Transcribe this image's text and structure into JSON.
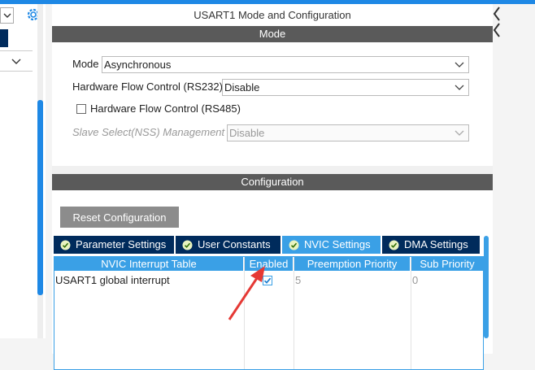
{
  "window": {
    "title": "USART1 Mode and Configuration"
  },
  "mode_section": {
    "header": "Mode",
    "mode_label": "Mode",
    "mode_value": "Asynchronous",
    "hfc232_label": "Hardware Flow Control (RS232)",
    "hfc232_value": "Disable",
    "hfc485_label": "Hardware Flow Control (RS485)",
    "hfc485_checked": false,
    "nss_label": "Slave Select(NSS) Management",
    "nss_value": "Disable"
  },
  "config_section": {
    "header": "Configuration",
    "reset_label": "Reset Configuration",
    "tabs": [
      {
        "label": "Parameter Settings",
        "active": false
      },
      {
        "label": "User Constants",
        "active": false
      },
      {
        "label": "NVIC Settings",
        "active": true
      },
      {
        "label": "DMA Settings",
        "active": false
      }
    ],
    "table": {
      "columns": [
        "NVIC Interrupt Table",
        "Enabled",
        "Preemption Priority",
        "Sub Priority"
      ],
      "rows": [
        {
          "name": "USART1 global interrupt",
          "enabled": true,
          "preemption": "5",
          "sub": "0"
        }
      ]
    }
  },
  "colors": {
    "accent": "#3aa0e6",
    "navy": "#002b5c",
    "header_gray": "#5a5a5a",
    "annotation_arrow": "#e53935"
  },
  "icons": [
    "gear-icon",
    "chevron-down-icon",
    "check-circle-icon",
    "checkbox-checked-icon",
    "collapse-left-icon"
  ]
}
